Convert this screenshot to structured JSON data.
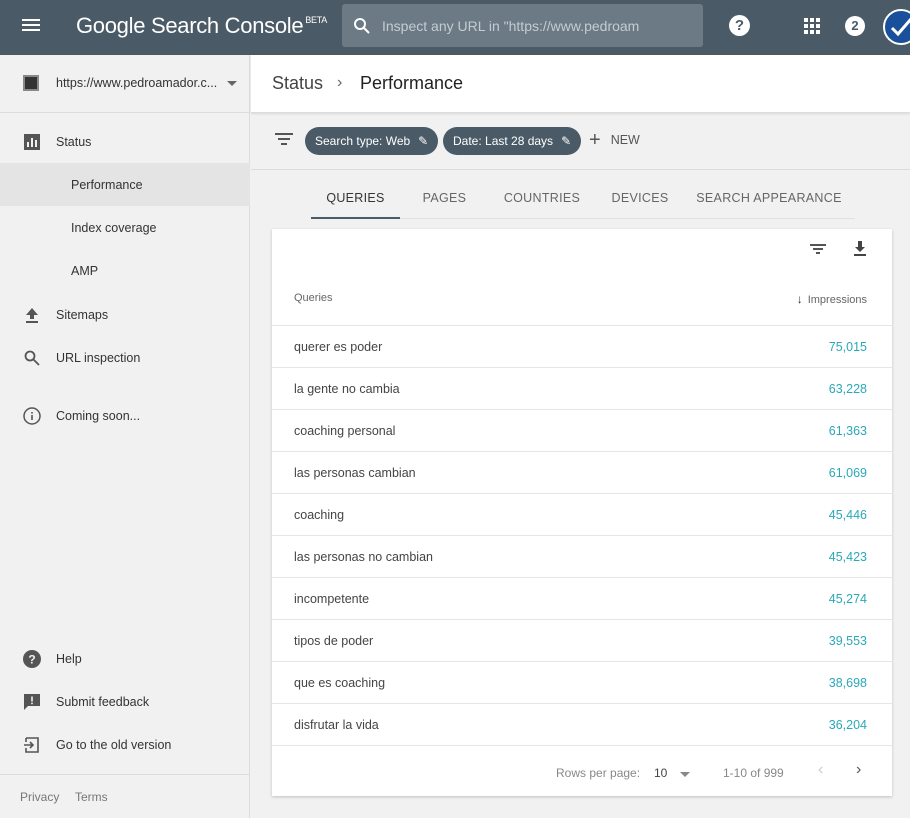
{
  "topbar": {
    "brand": "Google Search Console",
    "brand_badge": "BETA",
    "search_placeholder": "Inspect any URL in \"https://www.pedroam",
    "help_glyph": "?",
    "notification_count": "2"
  },
  "sidebar": {
    "property_url": "https://www.pedroamador.c...",
    "items": [
      {
        "label": "Status",
        "icon": "bar-chart-icon"
      },
      {
        "label": "Performance"
      },
      {
        "label": "Index coverage"
      },
      {
        "label": "AMP"
      },
      {
        "label": "Sitemaps",
        "icon": "upload-icon"
      },
      {
        "label": "URL inspection",
        "icon": "search-icon"
      },
      {
        "label": "Coming soon...",
        "icon": "info-icon"
      }
    ],
    "bottom_items": [
      {
        "label": "Help",
        "icon": "help-icon"
      },
      {
        "label": "Submit feedback",
        "icon": "feedback-icon"
      },
      {
        "label": "Go to the old version",
        "icon": "exit-icon"
      }
    ],
    "footer": {
      "privacy": "Privacy",
      "terms": "Terms"
    }
  },
  "header": {
    "breadcrumb_parent": "Status",
    "separator": "›",
    "page_title": "Performance"
  },
  "filters": {
    "chips": [
      {
        "label": "Search type: Web"
      },
      {
        "label": "Date: Last 28 days"
      }
    ],
    "new_label": "NEW"
  },
  "tabs": [
    "QUERIES",
    "PAGES",
    "COUNTRIES",
    "DEVICES",
    "SEARCH APPEARANCE"
  ],
  "table": {
    "col_queries": "Queries",
    "col_impressions": "Impressions",
    "rows": [
      {
        "query": "querer es poder",
        "impressions": "75,015"
      },
      {
        "query": "la gente no cambia",
        "impressions": "63,228"
      },
      {
        "query": "coaching personal",
        "impressions": "61,363"
      },
      {
        "query": "las personas cambian",
        "impressions": "61,069"
      },
      {
        "query": "coaching",
        "impressions": "45,446"
      },
      {
        "query": "las personas no cambian",
        "impressions": "45,423"
      },
      {
        "query": "incompetente",
        "impressions": "45,274"
      },
      {
        "query": "tipos de poder",
        "impressions": "39,553"
      },
      {
        "query": "que es coaching",
        "impressions": "38,698"
      },
      {
        "query": "disfrutar la vida",
        "impressions": "36,204"
      }
    ],
    "pager": {
      "rows_per_page_label": "Rows per page:",
      "rows_per_page": "10",
      "range": "1-10 of 999"
    }
  },
  "colors": {
    "topbar": "#4a5b67",
    "value": "#2aa8b8"
  }
}
